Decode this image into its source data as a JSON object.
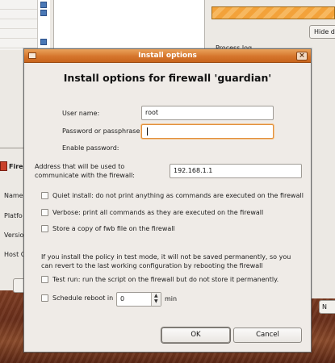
{
  "background": {
    "hide_button_label": "Hide d",
    "process_log_label": "Process log",
    "firewall_section_label": "Firew",
    "side_labels": [
      "Name",
      "Platfo",
      "Versio",
      "Host O"
    ],
    "right_button_label": "N"
  },
  "dialog": {
    "title": "Install options",
    "heading": "Install options for firewall 'guardian'",
    "close_glyph": "×",
    "user_name_label": "User name:",
    "user_name_value": "root",
    "password_label": "Password or passphrase:",
    "password_value": "",
    "enable_password_label": "Enable password:",
    "address_label": "Address that will be used to communicate with the firewall:",
    "address_value": "192.168.1.1",
    "checkboxes": [
      {
        "label": "Quiet install: do not print anything as commands are executed on the firewall",
        "checked": false
      },
      {
        "label": "Verbose: print all commands as they are executed on the firewall",
        "checked": false
      },
      {
        "label": "Store a copy of fwb file on the firewall",
        "checked": false
      }
    ],
    "test_mode_note": "If you install the policy in test mode, it will not be saved permanently, so you can revert to the last working configuration by rebooting the firewall",
    "test_run_label": "Test run: run the script on the firewall but do not store it permanently.",
    "test_run_checked": false,
    "schedule_reboot_label": "Schedule reboot in",
    "schedule_reboot_checked": false,
    "schedule_reboot_value": "0",
    "schedule_reboot_unit": "min",
    "ok_label": "OK",
    "cancel_label": "Cancel"
  },
  "colors": {
    "titlebar": "#d6762d",
    "focus_ring": "#e2903c",
    "progress": "#f3a23a"
  }
}
